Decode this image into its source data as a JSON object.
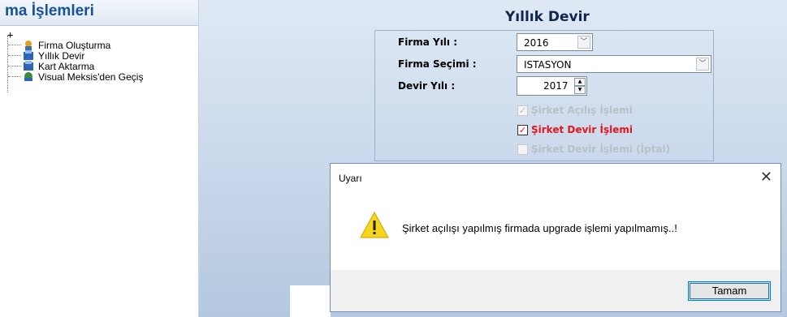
{
  "left_panel": {
    "title": "ma İşlemleri",
    "root_symbol": "+",
    "items": [
      {
        "label": "Firma Oluşturma",
        "icon": "firm-create-icon"
      },
      {
        "label": "Yıllık Devir",
        "icon": "yearly-transfer-icon"
      },
      {
        "label": "Kart Aktarma",
        "icon": "card-transfer-icon"
      },
      {
        "label": "Visual Meksis'den Geçiş",
        "icon": "migration-icon"
      }
    ]
  },
  "form": {
    "title": "Yıllık Devir",
    "firma_yili_label": "Firma Yılı :",
    "firma_yili_value": "2016",
    "firma_secimi_label": "Firma Seçimi :",
    "firma_secimi_value": "ISTASYON",
    "devir_yili_label": "Devir Yılı :",
    "devir_yili_value": "2017",
    "checkboxes": [
      {
        "label": "Şirket Açılış İşlemi",
        "checked": true,
        "enabled": false
      },
      {
        "label": "Şirket Devir İşlemi",
        "checked": true,
        "enabled": true
      },
      {
        "label": "Şirket Devir İşlemi (İptal)",
        "checked": false,
        "enabled": false
      }
    ]
  },
  "dialog": {
    "title": "Uyarı",
    "close_symbol": "✕",
    "message": "Şirket açılışı yapılmış firmada upgrade işlemi yapılmamış..!",
    "ok_label": "Tamam",
    "icon": "warning-icon"
  },
  "colors": {
    "accent_red": "#e8141c",
    "title_blue": "#17529b",
    "warning_yellow": "#f7d51d"
  }
}
